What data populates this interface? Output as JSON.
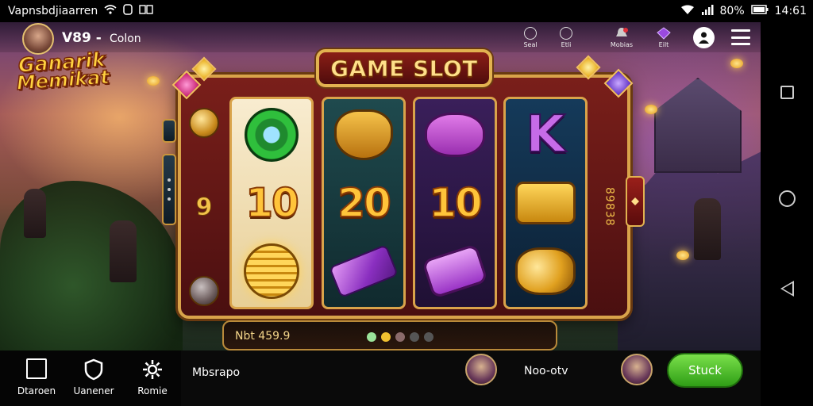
{
  "status_bar": {
    "left_text": "Vapnsbdjiaarren",
    "time": "14:61",
    "battery": "80%",
    "icons": [
      "wifi-icon",
      "notification-icon",
      "dual-sim-icon",
      "signal-icon",
      "battery-icon"
    ]
  },
  "player": {
    "id": "V89 -",
    "name": "Colon"
  },
  "top_icons": [
    {
      "label": "Seal",
      "icon": "circle-icon"
    },
    {
      "label": "Etli",
      "icon": "circle-icon"
    },
    {
      "label": "Mobias",
      "icon": "bell-icon"
    },
    {
      "label": "Eilt",
      "icon": "gem-icon"
    }
  ],
  "logo": {
    "line1": "Ganarik",
    "line2": "Memikat"
  },
  "machine": {
    "title": "GAME SLOT",
    "left_number": "9",
    "right_stack": "89838"
  },
  "reels": [
    {
      "symbols": [
        {
          "type": "ring-icon"
        },
        {
          "type": "number",
          "text": "10"
        },
        {
          "type": "coins-icon"
        }
      ]
    },
    {
      "symbols": [
        {
          "type": "mask-icon"
        },
        {
          "type": "number",
          "text": "20"
        },
        {
          "type": "purple-bar-icon"
        }
      ]
    },
    {
      "symbols": [
        {
          "type": "pig-icon"
        },
        {
          "type": "number",
          "text": "10"
        },
        {
          "type": "purse-icon"
        }
      ]
    },
    {
      "symbols": [
        {
          "type": "letter",
          "text": "K"
        },
        {
          "type": "wallet-icon"
        },
        {
          "type": "gold-pile-icon"
        }
      ]
    }
  ],
  "bet": {
    "text": "Nbt 459.9"
  },
  "page_dots": {
    "colors": [
      "#9be39b",
      "#f0c030",
      "#8a6a6a",
      "#555555",
      "#555555"
    ]
  },
  "bottom_nav": {
    "items": [
      {
        "label": "Dtaroen",
        "icon": "door-icon"
      },
      {
        "label": "Uanener",
        "icon": "shield-icon"
      },
      {
        "label": "Romie",
        "icon": "gear-icon"
      }
    ],
    "message": "Mbsrapo",
    "center_label": "Noo-otv",
    "action_button": "Stuck"
  }
}
